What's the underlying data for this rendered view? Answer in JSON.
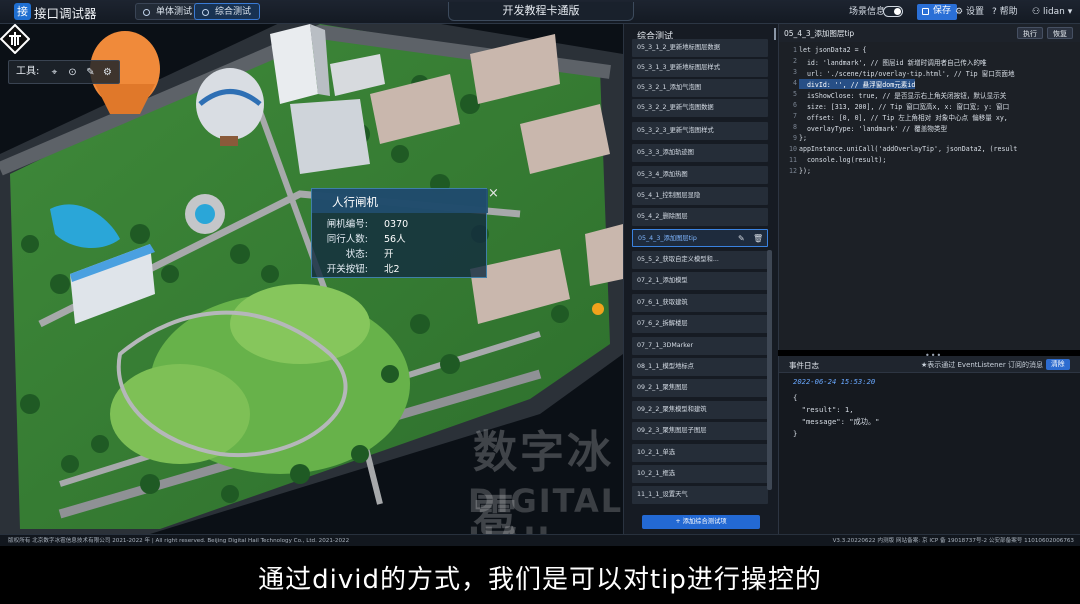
{
  "app": {
    "logo": "接",
    "title": "接口调试器"
  },
  "modes": [
    {
      "label": "单体测试",
      "active": false
    },
    {
      "label": "综合测试",
      "active": true
    }
  ],
  "center_title": "开发教程卡通版",
  "topbar_right": {
    "scene_info": "场景信息",
    "save": "保存",
    "settings": "设置",
    "help": "帮助",
    "user": "lidan"
  },
  "viewport": {
    "toolbox_label": "工具:",
    "tip": {
      "title": "人行闸机",
      "close": "×",
      "rows": [
        {
          "key": "闸机编号:",
          "value": "0370"
        },
        {
          "key": "同行人数:",
          "value": "56人"
        },
        {
          "key": "状态:",
          "value": "开"
        },
        {
          "key": "开关按钮:",
          "value": "北2"
        }
      ]
    },
    "watermark_cn": "数字冰雹",
    "watermark_en": "DIGITAL HAIL"
  },
  "panel": {
    "title": "综合测试",
    "items": [
      {
        "label": "05_3_1_2_更新地标图层数据",
        "active": false
      },
      {
        "label": "05_3_1_3_更新地标图层样式",
        "active": false
      },
      {
        "label": "05_3_2_1_添加气泡图",
        "active": false
      },
      {
        "label": "05_3_2_2_更新气泡图数据",
        "active": false
      },
      {
        "label": "05_3_2_3_更新气泡图样式",
        "active": false
      },
      {
        "label": "05_3_3_添加轨迹图",
        "active": false
      },
      {
        "label": "05_3_4_添加热图",
        "active": false
      },
      {
        "label": "05_4_1_控制图层显隐",
        "active": false
      },
      {
        "label": "05_4_2_删除图层",
        "active": false
      },
      {
        "label": "05_4_3_添加图层tip",
        "active": true
      },
      {
        "label": "05_5_2_获取自定义模型和...",
        "active": false
      },
      {
        "label": "07_2_1_添加模型",
        "active": false
      },
      {
        "label": "07_6_1_获取建筑",
        "active": false
      },
      {
        "label": "07_6_2_拆解楼层",
        "active": false
      },
      {
        "label": "07_7_1_3DMarker",
        "active": false
      },
      {
        "label": "08_1_1_模型地标点",
        "active": false
      },
      {
        "label": "09_2_1_聚焦图层",
        "active": false
      },
      {
        "label": "09_2_2_聚焦模型和建筑",
        "active": false
      },
      {
        "label": "09_2_3_聚焦图层子图层",
        "active": false
      },
      {
        "label": "10_2_1_单选",
        "active": false
      },
      {
        "label": "10_2_1_框选",
        "active": false
      },
      {
        "label": "11_1_1_设置天气",
        "active": false
      }
    ],
    "add_button": "+ 添加综合测试项"
  },
  "editor": {
    "tab": "05_4_3_添加图层tip",
    "run": "执行",
    "restore": "恢复",
    "lines": [
      "let jsonData2 = {",
      "  id: 'landmark', // 图层id 新增时调用者自己传入的唯",
      "  url: './scene/tip/overlay-tip.html', // Tip 窗口页面地",
      "  divId: '', // 悬浮窗dom元素id",
      "  isShowClose: true, // 是否显示右上角关闭按钮，默认显示关",
      "  size: [313, 200], // Tip 窗口宽高x, x: 窗口宽; y: 窗口",
      "  offset: [0, 0], // Tip 左上角相对 对象中心点 偏移量 xy,",
      "  overlayType: 'landmark' // 覆盖物类型",
      "};",
      "appInstance.uniCall('addOverlayTip', jsonData2, (result",
      "  console.log(result);",
      "});"
    ]
  },
  "log": {
    "title": "事件日志",
    "hint": "★表示通过 EventListener 订阅的消息",
    "clear": "清除",
    "time": "2022-06-24 15:53:20",
    "lines": [
      "{",
      "  \"result\": 1,",
      "  \"message\": \"成功。\"",
      "}"
    ]
  },
  "footer": {
    "left": "版权所有 北京数字冰雹信息技术有限公司 2021-2022 年 | All right reserved. Beijing Digital Hail Technology Co., Ltd. 2021-2022",
    "right": "V3.3.20220622 内测版  网站备案: 京 ICP 备 19018737号-2 公安部备案号 11010602006763"
  },
  "subtitle": "通过divid的方式，我们是可以对tip进行操控的"
}
